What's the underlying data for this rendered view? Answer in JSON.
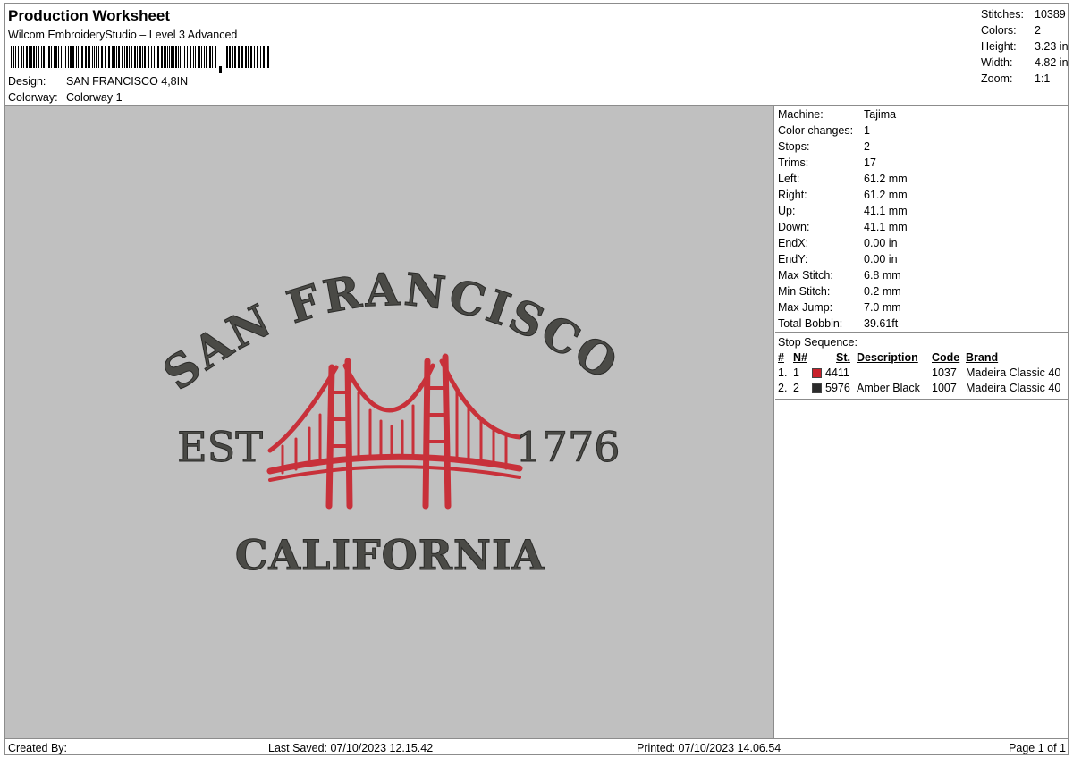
{
  "header": {
    "title": "Production Worksheet",
    "subtitle": "Wilcom EmbroideryStudio – Level 3 Advanced",
    "design_label": "Design:",
    "design_value": "SAN FRANCISCO 4,8IN",
    "colorway_label": "Colorway:",
    "colorway_value": "Colorway 1"
  },
  "stats": [
    {
      "label": "Stitches:",
      "value": "10389"
    },
    {
      "label": "Colors:",
      "value": "2"
    },
    {
      "label": "Height:",
      "value": "3.23 in"
    },
    {
      "label": "Width:",
      "value": "4.82 in"
    },
    {
      "label": "Zoom:",
      "value": "1:1"
    }
  ],
  "machine": [
    {
      "label": "Machine:",
      "value": "Tajima"
    },
    {
      "label": "Color changes:",
      "value": "1"
    },
    {
      "label": "Stops:",
      "value": "2"
    },
    {
      "label": "Trims:",
      "value": "17"
    },
    {
      "label": "Left:",
      "value": "61.2 mm"
    },
    {
      "label": "Right:",
      "value": "61.2 mm"
    },
    {
      "label": "Up:",
      "value": "41.1 mm"
    },
    {
      "label": "Down:",
      "value": "41.1 mm"
    },
    {
      "label": "EndX:",
      "value": "0.00 in"
    },
    {
      "label": "EndY:",
      "value": "0.00 in"
    },
    {
      "label": "Max Stitch:",
      "value": "6.8 mm"
    },
    {
      "label": "Min Stitch:",
      "value": "0.2 mm"
    },
    {
      "label": "Max Jump:",
      "value": "7.0 mm"
    },
    {
      "label": "Total Bobbin:",
      "value": "39.61ft"
    }
  ],
  "sequence": {
    "title": "Stop Sequence:",
    "headers": [
      "#",
      "N#",
      "St.",
      "Description",
      "Code",
      "Brand"
    ],
    "rows": [
      {
        "num": "1.",
        "n": "1",
        "color": "#c8202a",
        "st": "4411",
        "description": "",
        "code": "1037",
        "brand": "Madeira Classic 40"
      },
      {
        "num": "2.",
        "n": "2",
        "color": "#2b2b2b",
        "st": "5976",
        "description": "Amber Black",
        "code": "1007",
        "brand": "Madeira Classic 40"
      }
    ]
  },
  "design_art": {
    "arc_text": "SAN FRANCISCO",
    "left_text": "EST",
    "right_text": "1776",
    "bottom_text": "CALIFORNIA",
    "text_color": "#4a4a46",
    "bridge_color": "#c8313a",
    "background": "#c0c0c0"
  },
  "footer": {
    "created_by": "Created By:",
    "last_saved": "Last Saved: 07/10/2023 12.15.42",
    "printed": "Printed: 07/10/2023 14.06.54",
    "page": "Page 1 of 1"
  }
}
